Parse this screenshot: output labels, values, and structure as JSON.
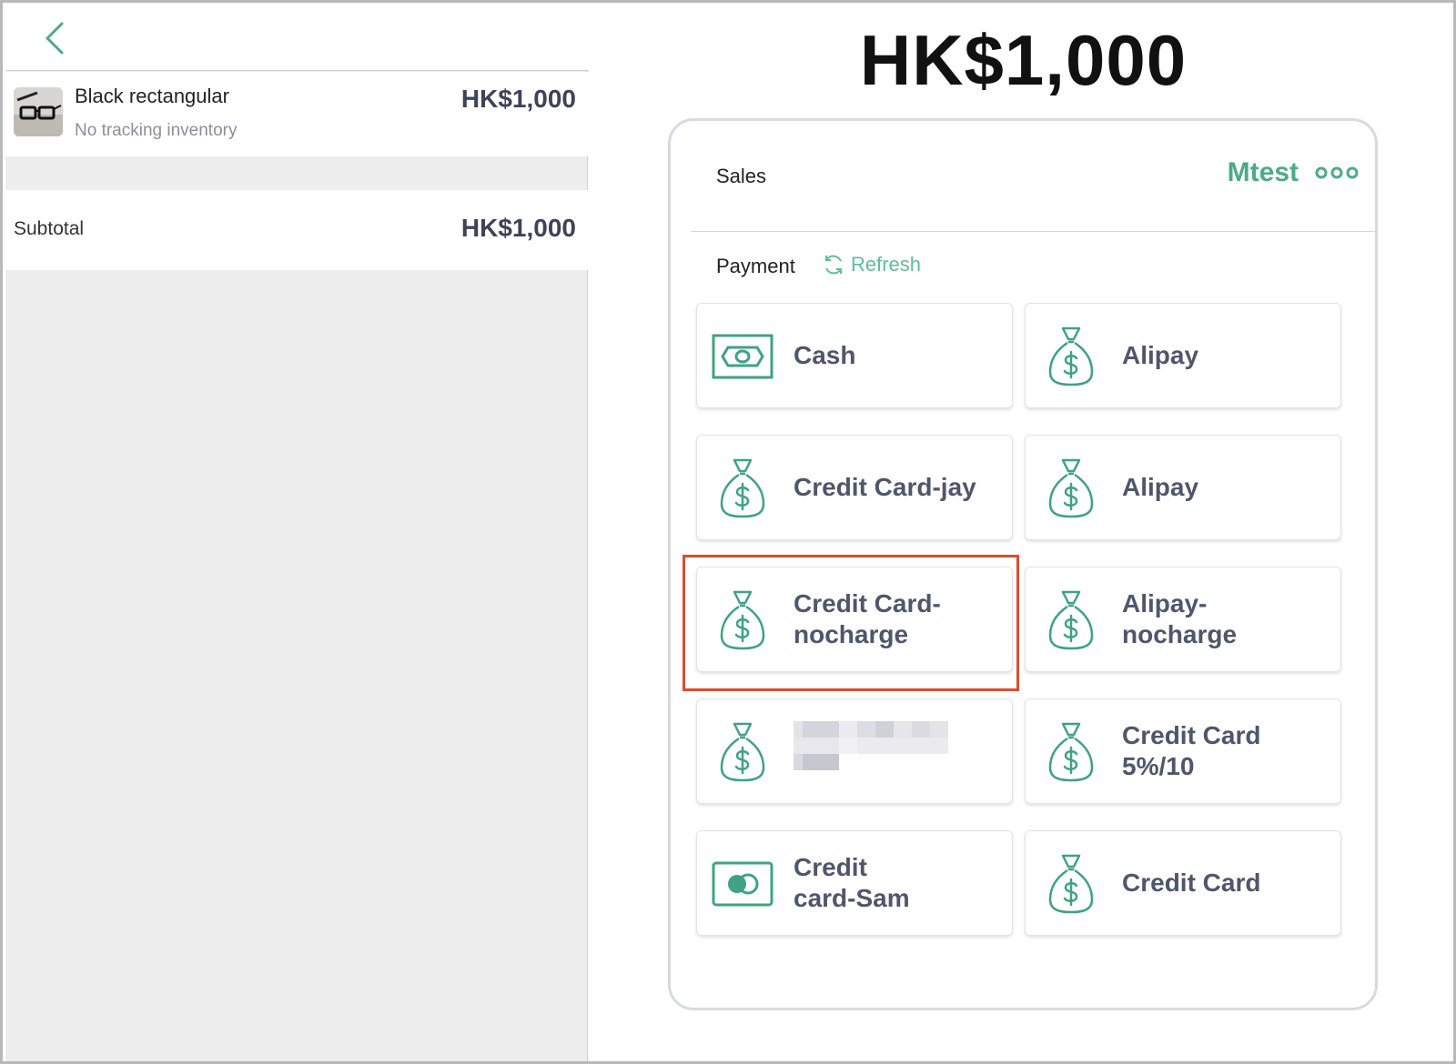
{
  "order": {
    "item": {
      "name": "Black rectangular",
      "subtitle": "No tracking inventory",
      "price": "HK$1,000"
    },
    "subtotal_label": "Subtotal",
    "subtotal_value": "HK$1,000"
  },
  "checkout": {
    "total": "HK$1,000",
    "sales_label": "Sales",
    "account_name": "Mtest",
    "payment_label": "Payment",
    "refresh_label": "Refresh",
    "methods": [
      {
        "label": "Cash",
        "icon": "cash-icon"
      },
      {
        "label": "Alipay",
        "icon": "money-bag-icon"
      },
      {
        "label": "Credit Card-jay",
        "icon": "money-bag-icon"
      },
      {
        "label": "Alipay",
        "icon": "money-bag-icon"
      },
      {
        "label": "Credit Card-nocharge",
        "icon": "money-bag-icon",
        "highlighted": true
      },
      {
        "label": "Alipay-nocharge",
        "icon": "money-bag-icon"
      },
      {
        "label": "",
        "icon": "money-bag-icon",
        "redacted": true
      },
      {
        "label": "Credit Card 5%/10",
        "icon": "money-bag-icon"
      },
      {
        "label": "Credit card-Sam",
        "icon": "credit-card-icon"
      },
      {
        "label": "Credit Card",
        "icon": "money-bag-icon"
      }
    ]
  },
  "colors": {
    "accent": "#4daa86",
    "button_text": "#4f566c",
    "highlight": "#e04a2f"
  }
}
